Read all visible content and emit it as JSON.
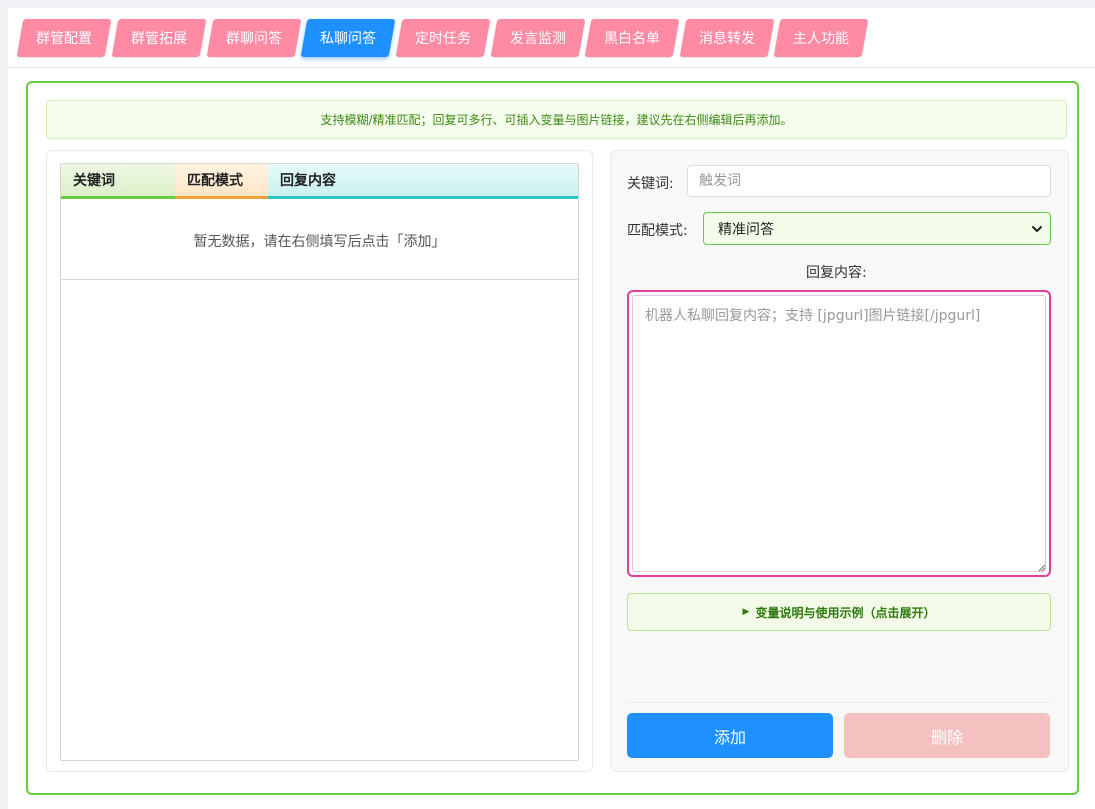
{
  "tabs": [
    {
      "label": "群管配置",
      "active": false
    },
    {
      "label": "群管拓展",
      "active": false
    },
    {
      "label": "群聊问答",
      "active": false
    },
    {
      "label": "私聊问答",
      "active": true
    },
    {
      "label": "定时任务",
      "active": false
    },
    {
      "label": "发言监测",
      "active": false
    },
    {
      "label": "黑白名单",
      "active": false
    },
    {
      "label": "消息转发",
      "active": false
    },
    {
      "label": "主人功能",
      "active": false
    }
  ],
  "notice": "支持模糊/精准匹配；回复可多行、可插入变量与图片链接，建议先在右侧编辑后再添加。",
  "table": {
    "headers": [
      "关键词",
      "匹配模式",
      "回复内容"
    ],
    "empty_text": "暂无数据，请在右侧填写后点击「添加」"
  },
  "form": {
    "keyword_label": "关键词:",
    "keyword_placeholder": "触发词",
    "keyword_value": "",
    "mode_label": "匹配模式:",
    "mode_value": "精准问答",
    "reply_label": "回复内容:",
    "reply_placeholder": "机器人私聊回复内容；支持 [jpgurl]图片链接[/jpgurl]",
    "help_toggle": "变量说明与使用示例（点击展开）",
    "add_button": "添加",
    "delete_button": "删除"
  },
  "icons": {
    "select_arrow": "chevron-down-icon",
    "help_toggle": "triangle-right-icon",
    "resize_grip": "resize-grip-icon"
  },
  "colors": {
    "tab": "#ff8aa4",
    "tab_active": "#1e90ff",
    "panel_border": "#66cc44",
    "textarea_border": "#e0409a",
    "add_button": "#1e90ff",
    "delete_button": "#f4c0c0"
  }
}
